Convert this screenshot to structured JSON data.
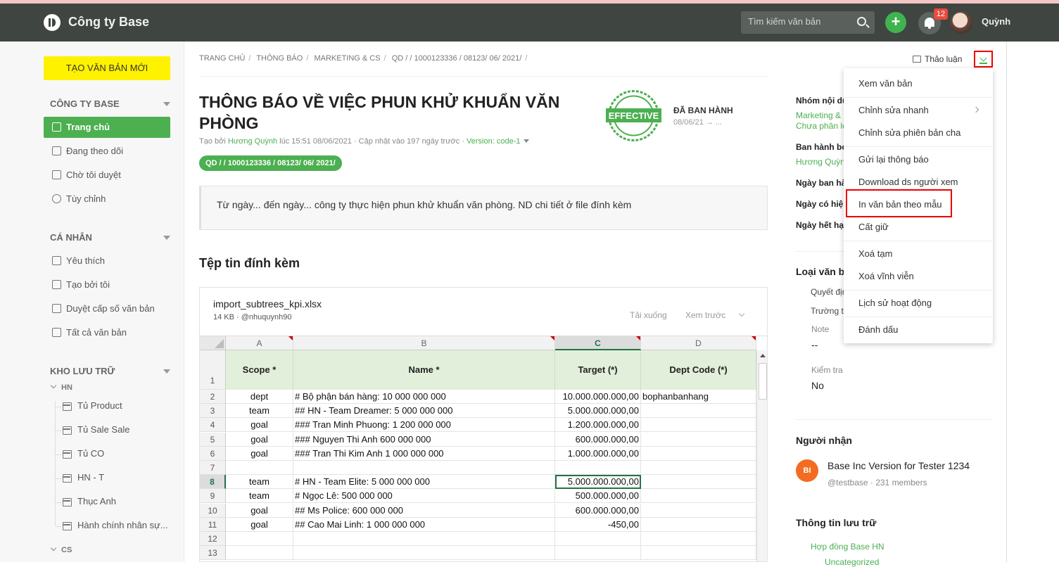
{
  "topbar": {
    "company": "Công ty Base",
    "search_placeholder": "Tìm kiếm văn bản",
    "plus": "+",
    "notification_count": "12",
    "username": "Quỳnh"
  },
  "sidebar": {
    "new_doc": "TẠO VĂN BẢN MỚI",
    "section_company": "CÔNG TY BASE",
    "company_items": [
      "Trang chủ",
      "Đang theo dõi",
      "Chờ tôi duyệt",
      "Tùy chỉnh"
    ],
    "section_personal": "CÁ NHÂN",
    "personal_items": [
      "Yêu thích",
      "Tạo bởi tôi",
      "Duyệt cấp số văn bản",
      "Tất cả văn bản"
    ],
    "section_storage": "KHO LƯU TRỮ",
    "group_hn": "HN",
    "hn_items": [
      "Tủ Product",
      "Tủ Sale Sale",
      "Tủ CO",
      "HN - T",
      "Thục Anh",
      "Hành chính nhân sự..."
    ],
    "group_cs": "CS"
  },
  "breadcrumb": [
    "TRANG CHỦ",
    "THÔNG BÁO",
    "MARKETING & CS",
    "QD / / 1000123336 / 08123/ 06/ 2021/"
  ],
  "discussion": "Thảo luận",
  "document": {
    "title": "THÔNG BÁO VỀ VIỆC PHUN KHỬ KHUẨN VĂN PHÒNG",
    "created_prefix": "Tạo bởi ",
    "creator": "Hương Quỳnh",
    "created_suffix": " lúc 15:51 08/06/2021 · Cập nhật vào 197 ngày trước · ",
    "version": "Version: code-1",
    "code": "QD / / 1000123336 / 08123/ 06/ 2021/",
    "stamp_text": "EFFECTIVE",
    "status": "ĐÃ BAN HÀNH",
    "status_date": "08/06/21 → ...",
    "summary": "Từ ngày... đến ngày... công ty thực hiện phun khử khuẩn văn phòng. ND chi tiết ở file đính kèm"
  },
  "attachments": {
    "heading": "Tệp tin đính kèm",
    "file_name": "import_subtrees_kpi.xlsx",
    "file_meta": "14 KB · @nhuquynh90",
    "download": "Tải xuống",
    "preview": "Xem trước"
  },
  "sheet": {
    "columns": [
      "A",
      "B",
      "C",
      "D"
    ],
    "headers": [
      "Scope  *",
      "Name  *",
      "Target (*)",
      "Dept Code (*)"
    ],
    "row_numbers": [
      "1",
      "2",
      "3",
      "4",
      "5",
      "6",
      "7",
      "8",
      "9",
      "10",
      "11",
      "12",
      "13"
    ],
    "rows": [
      [
        "dept",
        "# Bộ phận bán hàng: 10 000 000 000",
        "10.000.000.000,00",
        "bophanbanhang"
      ],
      [
        "team",
        "## HN - Team Dreamer: 5 000 000 000",
        "5.000.000.000,00",
        ""
      ],
      [
        "goal",
        "### Tran Minh Phuong: 1 200 000 000",
        "1.200.000.000,00",
        ""
      ],
      [
        "goal",
        "### Nguyen Thi Anh 600 000 000",
        "600.000.000,00",
        ""
      ],
      [
        "goal",
        "### Tran Thi Kim Anh 1 000 000 000",
        "1.000.000.000,00",
        ""
      ],
      [
        "",
        "",
        "",
        ""
      ],
      [
        "team",
        "# HN - Team Elite: 5 000 000 000",
        "5.000.000.000,00",
        ""
      ],
      [
        "team",
        "# Ngọc Lê: 500 000 000",
        "500.000.000,00",
        ""
      ],
      [
        "goal",
        "## Ms Police: 600 000 000",
        "600.000.000,00",
        ""
      ],
      [
        "goal",
        "## Cao Mai Linh: 1 000 000 000",
        "-450,00",
        ""
      ],
      [
        "",
        "",
        "",
        ""
      ],
      [
        "",
        "",
        "",
        ""
      ]
    ]
  },
  "right_panel": {
    "group_label": "Nhóm nội dung",
    "group_value_1": "Marketing & CS",
    "group_value_2": "Chưa phân loại",
    "issuer_label": "Ban hành bởi",
    "issuer_value": "Hương Quỳnh",
    "issue_date_label": "Ngày ban hành",
    "effective_label": "Ngày có hiệu lực",
    "expiry_label": "Ngày hết hạn",
    "type_heading": "Loại văn bản",
    "type_1": "Quyết định",
    "type_2": "Trường thông tin",
    "note_label": "Note",
    "note_value": "--",
    "check_label": "Kiểm tra",
    "check_value": "No",
    "recipients_heading": "Người nhận",
    "recipient_initials": "BI",
    "recipient_name": "Base Inc Version for Tester 1234",
    "recipient_meta": "@testbase · 231 members",
    "storage_heading": "Thông tin lưu trữ",
    "storage_value": "Hợp đồng Base HN",
    "storage_sub": "Uncategorized"
  },
  "menu": {
    "items": [
      "Xem văn bản",
      "Chỉnh sửa nhanh",
      "Chỉnh sửa phiên bản cha",
      "Gửi lại thông báo",
      "Download ds người xem",
      "In văn bản theo mẫu",
      "Cất giữ",
      "Xoá tạm",
      "Xoá vĩnh viễn",
      "Lịch sử hoạt động",
      "Đánh dấu"
    ]
  }
}
